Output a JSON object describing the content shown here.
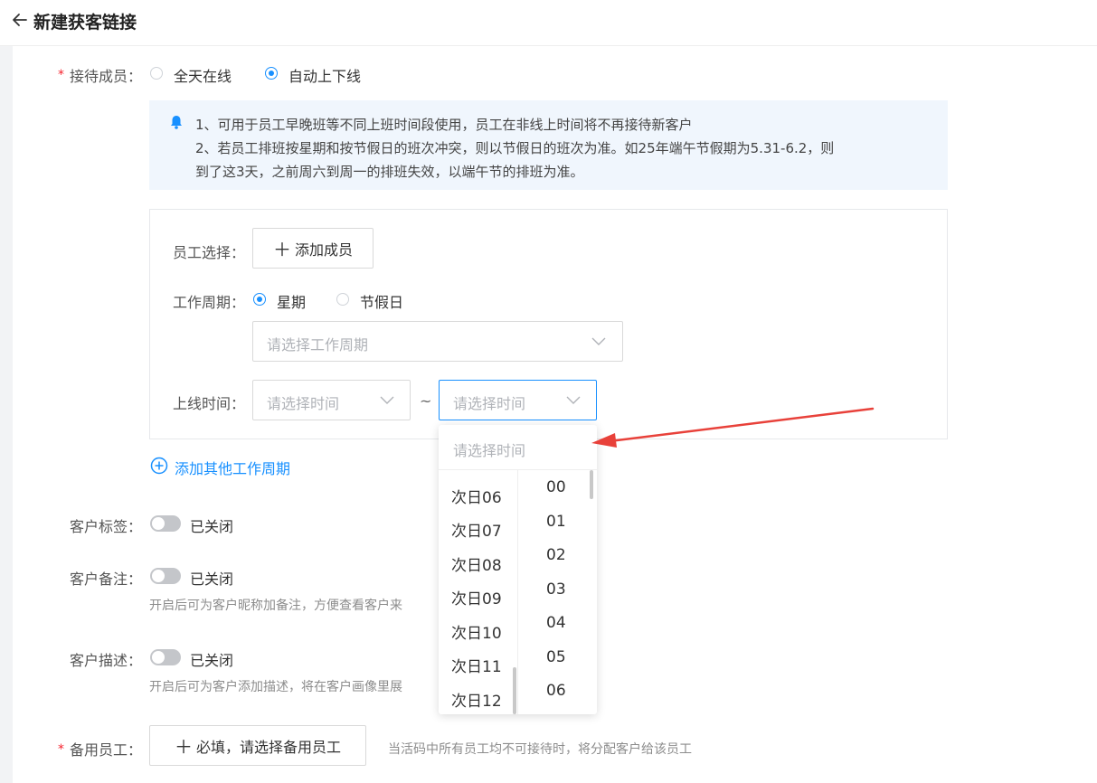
{
  "header": {
    "title": "新建获客链接",
    "back_icon": "arrow-left-icon"
  },
  "reception": {
    "label": "接待成员",
    "required_mark": "*",
    "colon": "：",
    "options": [
      {
        "label": "全天在线",
        "selected": false
      },
      {
        "label": "自动上下线",
        "selected": true
      }
    ]
  },
  "notice": {
    "icon": "bell-icon",
    "lines": [
      "1、可用于员工早晚班等不同上班时间段使用，员工在非线上时间将不再接待新客户",
      "2、若员工排班按星期和按节假日的班次冲突，则以节假日的班次为准。如25年端午节假期为5.31-6.2，则",
      "到了这3天，之前周六到周一的排班失效，以端午节的排班为准。"
    ]
  },
  "schedule": {
    "staff_label": "员工选择：",
    "add_member_button": "添加成员",
    "period_label": "工作周期：",
    "period_options": [
      {
        "label": "星期",
        "selected": true
      },
      {
        "label": "节假日",
        "selected": false
      }
    ],
    "period_placeholder": "请选择工作周期",
    "online_time_label": "上线时间：",
    "start_placeholder": "请选择时间",
    "separator": "~",
    "end_placeholder": "请选择时间",
    "add_period_link": "添加其他工作周期"
  },
  "time_dropdown": {
    "search_placeholder": "请选择时间",
    "hours": [
      "次日06",
      "次日07",
      "次日08",
      "次日09",
      "次日10",
      "次日11",
      "次日12"
    ],
    "minutes": [
      "00",
      "01",
      "02",
      "03",
      "04",
      "05",
      "06"
    ]
  },
  "customer_tag": {
    "label": "客户标签：",
    "status": "已关闭",
    "enabled": false
  },
  "customer_remark": {
    "label": "客户备注：",
    "status": "已关闭",
    "enabled": false,
    "hint": "开启后可为客户昵称加备注，方便查看客户来"
  },
  "customer_desc": {
    "label": "客户描述：",
    "status": "已关闭",
    "enabled": false,
    "hint": "开启后可为客户添加描述，将在客户画像里展"
  },
  "backup_staff": {
    "label": "备用员工：",
    "required_mark": "*",
    "button": "必填，请选择备用员工",
    "hint": "当活码中所有员工均不可接待时，将分配客户给该员工"
  },
  "colors": {
    "accent": "#1890ff",
    "notice_bg": "#f0f6fd",
    "required": "#f5222d",
    "arrow": "#e8413a"
  }
}
